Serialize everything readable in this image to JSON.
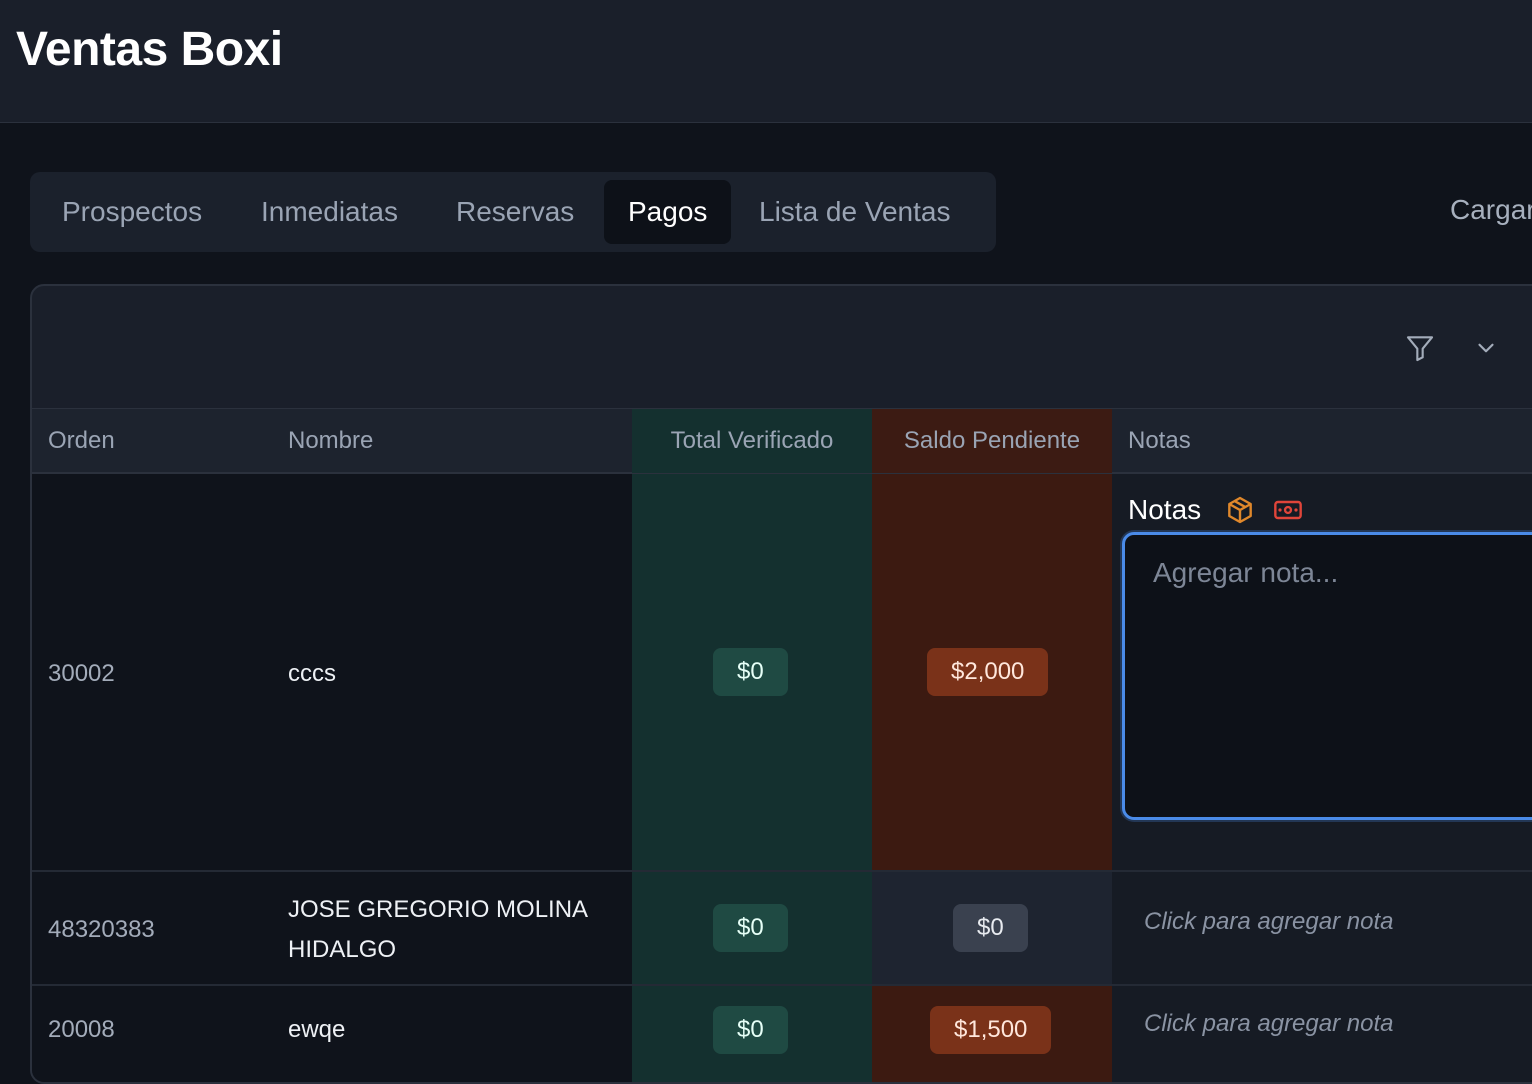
{
  "app": {
    "title": "Ventas Boxi"
  },
  "tabs": [
    {
      "label": "Prospectos",
      "active": false
    },
    {
      "label": "Inmediatas",
      "active": false
    },
    {
      "label": "Reservas",
      "active": false
    },
    {
      "label": "Pagos",
      "active": true
    },
    {
      "label": "Lista de Ventas",
      "active": false
    }
  ],
  "actions": {
    "cargar_label": "Cargar"
  },
  "toolbar": {
    "filter_icon": "filter-icon",
    "expand_icon": "chevron-down-icon"
  },
  "table": {
    "columns": [
      "Orden",
      "Nombre",
      "Total Verificado",
      "Saldo Pendiente",
      "Notas"
    ],
    "rows": [
      {
        "orden": "30002",
        "nombre": "cccs",
        "total_verificado": "$0",
        "saldo_pendiente": "$2,000",
        "notes_editor": {
          "label": "Notas",
          "placeholder": "Agregar nota...",
          "icons": [
            "package-icon",
            "banknote-icon"
          ]
        }
      },
      {
        "orden": "48320383",
        "nombre": "JOSE GREGORIO MOLINA HIDALGO",
        "total_verificado": "$0",
        "saldo_pendiente": "$0",
        "note_prompt": "Click para agregar nota"
      },
      {
        "orden": "20008",
        "nombre": "ewqe",
        "total_verificado": "$0",
        "saldo_pendiente": "$1,500",
        "note_prompt": "Click para agregar nota"
      }
    ]
  },
  "colors": {
    "accent_focus": "#4a8be8",
    "verified_bg": "#14302f",
    "pending_bg": "#3c1a11",
    "badge_green": "#1f4a43",
    "badge_orange": "#7a3219",
    "icon_orange": "#e0882b",
    "icon_red": "#e0453a"
  }
}
